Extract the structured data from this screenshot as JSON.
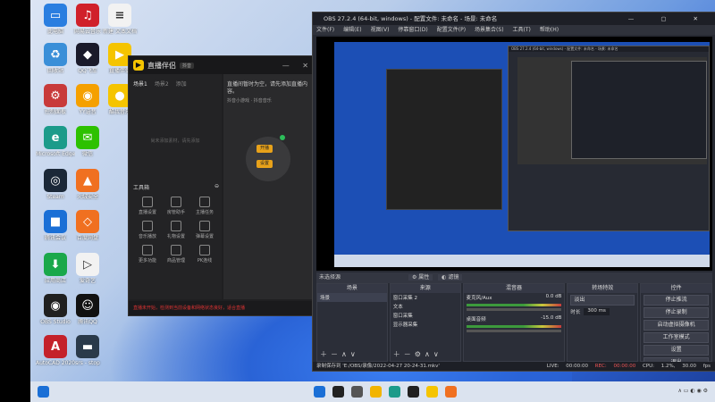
{
  "desktop": {
    "icons": [
      {
        "label": "此电脑",
        "color": "#2a7ee0",
        "glyph": "▭"
      },
      {
        "label": "网易云音乐",
        "color": "#d0202a",
        "glyph": "♫"
      },
      {
        "label": "新建 文本文档",
        "color": "#f2f2f2",
        "glyph": "≡"
      },
      {
        "label": "回收站",
        "color": "#3a8fd8",
        "glyph": "♻"
      },
      {
        "label": "QQ飞车",
        "color": "#1a1a2a",
        "glyph": "◆"
      },
      {
        "label": "直播伴侣",
        "color": "#f5c400",
        "glyph": "▶"
      },
      {
        "label": "控制面板",
        "color": "#c83a3a",
        "glyph": "⚙"
      },
      {
        "label": "YY语音",
        "color": "#f5a000",
        "glyph": "◉"
      },
      {
        "label": "酷我音乐",
        "color": "#f5c400",
        "glyph": "●"
      },
      {
        "label": "Microsoft Edge",
        "color": "#1c9b8a",
        "glyph": "e"
      },
      {
        "label": "微信",
        "color": "#2dc100",
        "glyph": "✉"
      },
      {
        "label": "Steam",
        "color": "#1b2838",
        "glyph": "◎"
      },
      {
        "label": "火绒安全",
        "color": "#f07020",
        "glyph": "▲"
      },
      {
        "label": "腾讯会议",
        "color": "#1a6fd6",
        "glyph": "■"
      },
      {
        "label": "百度网盘",
        "color": "#f07020",
        "glyph": "◇"
      },
      {
        "label": "应用商店",
        "color": "#1aa84a",
        "glyph": "⬇"
      },
      {
        "label": "爱奇艺",
        "color": "#f2f2f2",
        "glyph": "▷"
      },
      {
        "label": "OBS Studio",
        "color": "#202020",
        "glyph": "◉"
      },
      {
        "label": "腾讯QQ",
        "color": "#111111",
        "glyph": "☺"
      },
      {
        "label": "AutoCAD 2020",
        "color": "#c4212a",
        "glyph": "A"
      },
      {
        "label": "srs - stop",
        "color": "#2a3a4a",
        "glyph": "▬"
      }
    ]
  },
  "zbbl": {
    "title": "直播伴侣",
    "badge": "抖音",
    "tabs": [
      "场景1",
      "场景2",
      "添加"
    ],
    "empty_hint": "尚未添加素材，请先添加",
    "tools_label": "工具箱",
    "tools": [
      "直播设置",
      "房管助手",
      "主播任务",
      "音乐播放",
      "礼物设置",
      "弹幕设置",
      "更多功能",
      "商品管理",
      "PK连线"
    ],
    "banner": "直播间暂时为空，请先添加直播内容。",
    "sub": "抖音小游戏 · 抖音音乐",
    "btn_start": "开播",
    "btn_settings": "设置",
    "footer": "直播未开始，检测到当前设备和网络状态良好，适合直播"
  },
  "obs": {
    "title": "OBS 27.2.4 (64-bit, windows) - 配置文件: 未命名 - 场景: 未命名",
    "menu": [
      "文件(F)",
      "编辑(E)",
      "视图(V)",
      "停靠窗口(D)",
      "配置文件(P)",
      "场景集合(S)",
      "工具(T)",
      "帮助(H)"
    ],
    "source_bar": "未选择源",
    "props_btn": "属性",
    "filter_btn": "滤镜",
    "docks": {
      "scenes": {
        "title": "场景",
        "items": [
          "场景"
        ]
      },
      "sources": {
        "title": "来源",
        "items": [
          "窗口采集 2",
          "文本",
          "窗口采集",
          "显示器采集"
        ]
      },
      "mixer": {
        "title": "混音器",
        "channels": [
          {
            "name": "麦克风/Aux",
            "db": "0.0 dB"
          },
          {
            "name": "桌面音频",
            "db": "-15.0 dB"
          }
        ]
      },
      "transitions": {
        "title": "转场特效",
        "type": "淡出",
        "duration_label": "时长",
        "duration": "300 ms"
      },
      "controls": {
        "title": "控件",
        "buttons": [
          "停止推流",
          "停止录制",
          "启动虚拟摄像机",
          "工作室模式",
          "设置",
          "退出"
        ]
      }
    },
    "status": {
      "save_path": "录制保存到 'E:/OBS/录像/2022-04-27 20-24-31.mkv'",
      "live": "LIVE: 00:00:00",
      "rec": "REC: 00:00:00",
      "cpu": "CPU: 1.2%, 30.00 fps"
    }
  },
  "taskbar": {
    "apps": [
      "开始",
      "搜索",
      "任务视图",
      "文件资源管理器",
      "Edge",
      "OBS Studio",
      "直播伴侣",
      "QQ飞车"
    ]
  }
}
